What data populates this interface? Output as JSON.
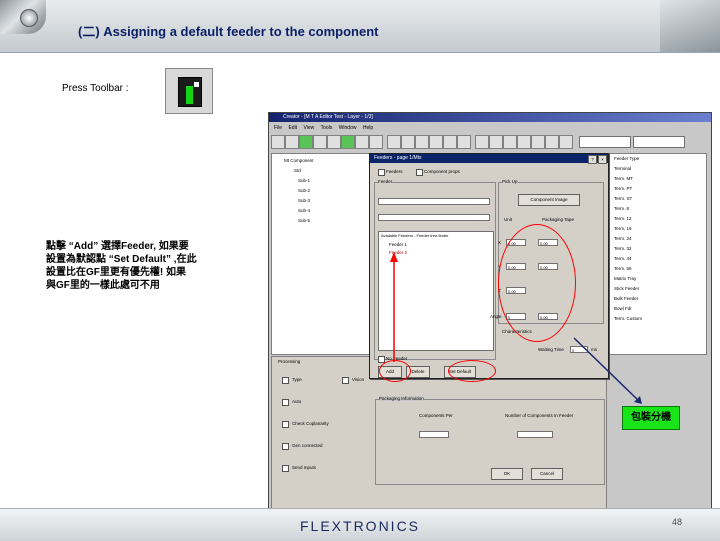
{
  "slide": {
    "title": "(二) Assigning a default feeder to the component",
    "press_label": "Press Toolbar :",
    "note_line1": "點擊 “Add” 選擇Feeder, 如果要",
    "note_line2": "設置為默認點 “Set Default” ,在此",
    "note_line3": "設置比在GF里更有優先權! 如果",
    "note_line4": "與GF里的一樣此處可不用",
    "callout": "包裝分機",
    "footer_logo": "FLEXTRONICS",
    "page_number": "48"
  },
  "app": {
    "window_title": "Creator - [M T A  Editor  Test - Layer - 1/3]",
    "menu": [
      "File",
      "Edit",
      "View",
      "Tools",
      "Window",
      "Help"
    ],
    "right_list": [
      "Feeder Type",
      "Terminal",
      "Term. MT",
      "Term. PT",
      "Term. ST",
      "Term. 8",
      "Term. 12",
      "Term. 16",
      "Term. 24",
      "Term. 32",
      "Term. 44",
      "Term. 56",
      "Matrix Tray",
      "Stick Feeder",
      "Bulk Feeder",
      "Bowl Fdr",
      "Term. Custom"
    ],
    "tree_items": [
      "Mt Component",
      "Std",
      "Sub-1",
      "Sub-2",
      "Sub-3",
      "Sub-4",
      "Sub-5"
    ]
  },
  "dialog": {
    "title": "Feeders - page 1/Mts",
    "tab1": "Feeders",
    "tab2": "Component props",
    "group_feeder": "Feeder",
    "group_pickup": "Pick Up",
    "btn_component_image": "Component Image",
    "label_unit": "Unit",
    "label_packaging": "Packaging Tape",
    "list_header": "Available Feeders - Feeder tree-finder",
    "list_items": [
      "Feeder 1",
      "Feeder 2"
    ],
    "label_x": "X",
    "label_y": "Y",
    "label_z": "Z",
    "label_angle": "Angle",
    "val_x": "0.00",
    "val_y": "0.00",
    "val_z": "0.00",
    "val_angle": "0",
    "val_x2": "0.00",
    "val_y2": "0.00",
    "val_angle2": "0.00",
    "label_char": "Characteristics",
    "label_waiting": "Waiting Time",
    "val_waiting": "0",
    "unit_ms": "ms",
    "no_feeder": "No Feeder",
    "btn_add": "Add",
    "btn_delete": "Delete",
    "btn_set_default": "Set Default",
    "label_packaging_info": "Packaging Information",
    "label_comp_per": "Components Per",
    "label_number_of": "Number of Components In Feeder",
    "btn_ok": "OK",
    "btn_cancel": "Cancel"
  },
  "panel": {
    "title": "Processing",
    "check1": "Type",
    "check2": "Vision",
    "check3": "Auto",
    "check4": "Check Coplanarity",
    "check5": "Gen connected",
    "check6": "Send Inputs"
  }
}
